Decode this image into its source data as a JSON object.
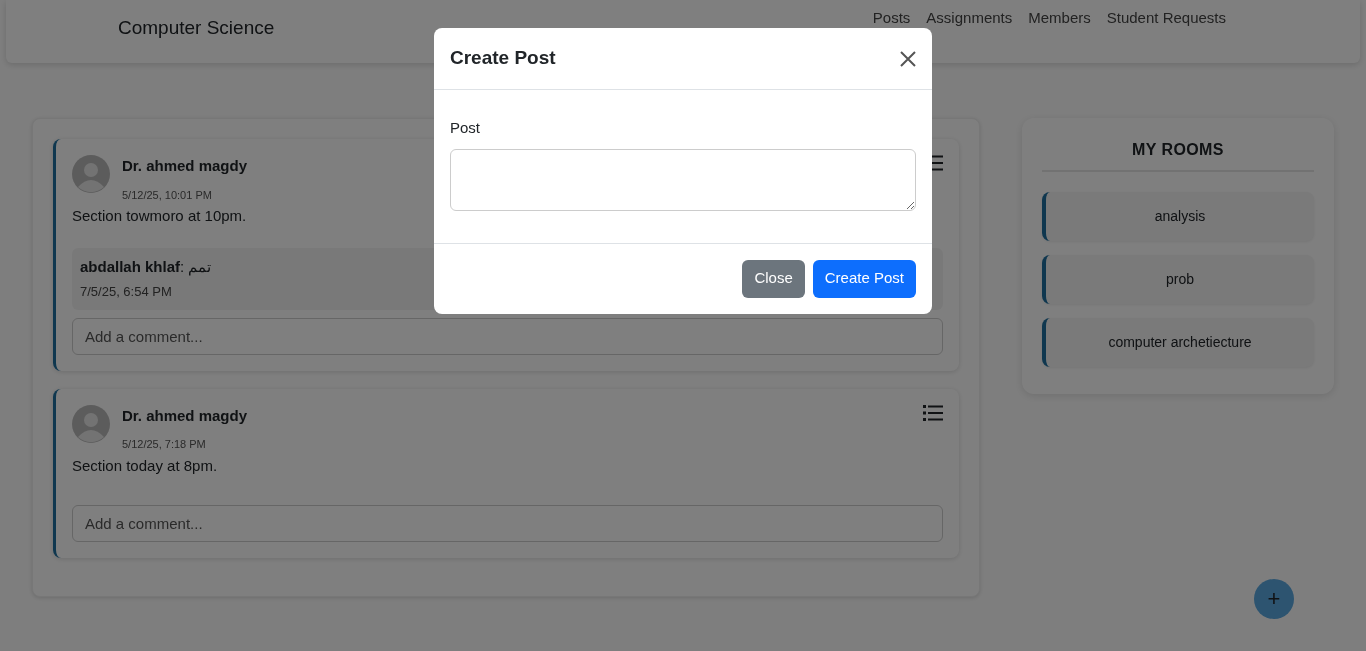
{
  "navbar": {
    "title": "Computer Science",
    "links": [
      {
        "label": "Posts"
      },
      {
        "label": "Assignments"
      },
      {
        "label": "Members"
      },
      {
        "label": "Student Requests"
      }
    ]
  },
  "posts": [
    {
      "author": "Dr. ahmed magdy",
      "time": "5/12/25, 10:01 PM",
      "text": "Section towmoro at 10pm.",
      "comments": [
        {
          "line": "**abdallah khlaf**: تمم",
          "time": "7/5/25, 6:54 PM"
        }
      ],
      "comment_placeholder": "Add a comment..."
    },
    {
      "author": "Dr. ahmed magdy",
      "time": "5/12/25, 7:18 PM",
      "text": "Section today at 8pm.",
      "comment_placeholder": "Add a comment..."
    }
  ],
  "rooms": {
    "title": "MY ROOMS",
    "items": [
      {
        "name": "analysis"
      },
      {
        "name": "prob"
      },
      {
        "name": "computer archetiecture"
      }
    ]
  },
  "fab": {
    "label": "+"
  },
  "modal": {
    "title": "Create Post",
    "field_label": "Post",
    "buttons": [
      {
        "label": "Close",
        "kind": "secondary"
      },
      {
        "label": "Create Post",
        "kind": "primary"
      }
    ]
  }
}
